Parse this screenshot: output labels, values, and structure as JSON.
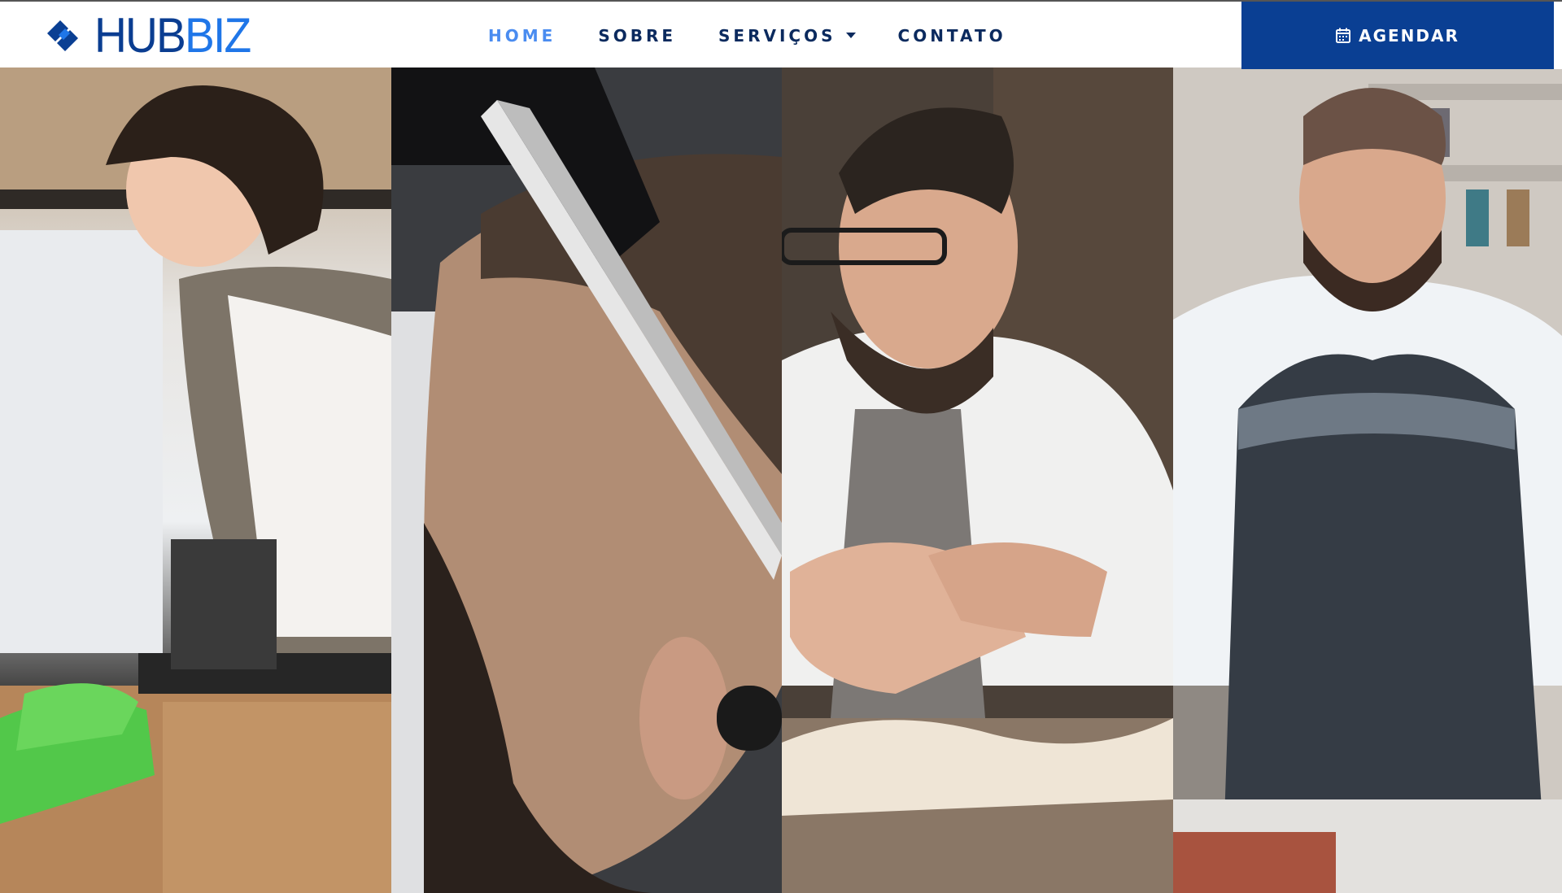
{
  "header": {
    "logo": {
      "hub": "HUB",
      "biz": "BIZ"
    },
    "nav": [
      {
        "label": "HOME",
        "active": true
      },
      {
        "label": "SOBRE",
        "active": false
      },
      {
        "label": "SERVIÇOS",
        "active": false,
        "has_dropdown": true
      },
      {
        "label": "CONTATO",
        "active": false
      }
    ],
    "cta": {
      "label": "AGENDAR",
      "icon": "calendar-icon"
    }
  },
  "hero": {
    "panels": [
      {
        "subject": "cleaning-photo"
      },
      {
        "subject": "barber-photo"
      },
      {
        "subject": "woodcarving-photo"
      },
      {
        "subject": "craftsman-photo"
      }
    ]
  },
  "colors": {
    "brand_dark": "#0a3f93",
    "brand_light": "#1f76e8",
    "nav_text": "#0b2a5e",
    "nav_active": "#4a8cf0"
  }
}
